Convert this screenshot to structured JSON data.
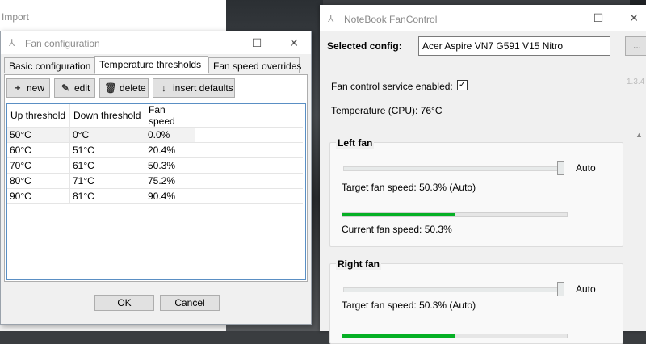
{
  "import_window": {
    "title": "Import"
  },
  "fan_config": {
    "title": "Fan configuration",
    "window_buttons": {
      "minimize": "—",
      "maximize": "☐",
      "close": "✕"
    },
    "tabs": [
      {
        "label": "Basic configuration",
        "active": false
      },
      {
        "label": "Temperature thresholds",
        "active": true
      },
      {
        "label": "Fan speed overrides",
        "active": false
      }
    ],
    "toolbar": {
      "new": "new",
      "edit": "edit",
      "delete": "delete",
      "insert_defaults": "insert defaults"
    },
    "columns": [
      "Up threshold",
      "Down threshold",
      "Fan speed"
    ],
    "rows": [
      [
        "50°C",
        "0°C",
        "0.0%"
      ],
      [
        "60°C",
        "51°C",
        "20.4%"
      ],
      [
        "70°C",
        "61°C",
        "50.3%"
      ],
      [
        "80°C",
        "71°C",
        "75.2%"
      ],
      [
        "90°C",
        "81°C",
        "90.4%"
      ]
    ],
    "ok": "OK",
    "cancel": "Cancel"
  },
  "nbfc": {
    "title": "NoteBook FanControl",
    "window_buttons": {
      "minimize": "—",
      "maximize": "☐",
      "close": "✕"
    },
    "selected_config_label": "Selected config:",
    "selected_config_value": "Acer Aspire VN7 G591 V15 Nitro",
    "browse": "...",
    "version": "1.3.4",
    "service_enabled_label": "Fan control service enabled:",
    "service_enabled": true,
    "temperature_text": "Temperature (CPU): 76°C",
    "fans": [
      {
        "title": "Left fan",
        "auto_label": "Auto",
        "slider_value": 100,
        "target_text": "Target fan speed:  50.3% (Auto)",
        "current_text": "Current fan speed:  50.3%",
        "current_fraction": 0.503
      },
      {
        "title": "Right fan",
        "auto_label": "Auto",
        "slider_value": 100,
        "target_text": "Target fan speed:  50.3% (Auto)",
        "current_text": "",
        "current_fraction": 0.503
      }
    ],
    "colors": {
      "progress": "#06b025"
    }
  }
}
